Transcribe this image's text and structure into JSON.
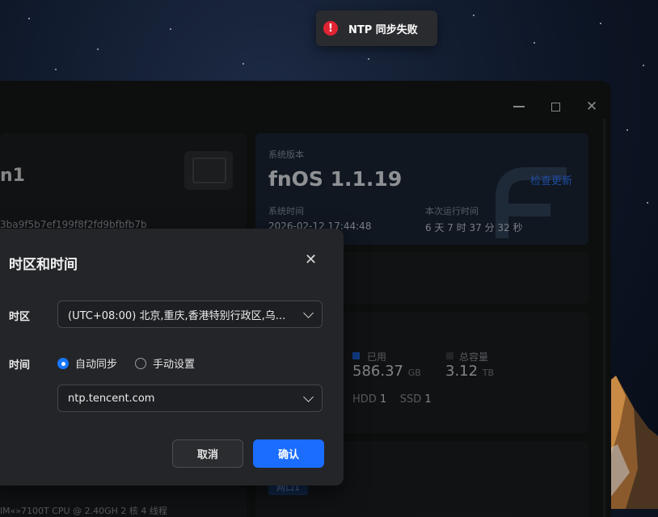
{
  "toast": {
    "icon": "error-icon",
    "message": "NTP 同步失败"
  },
  "window": {
    "controls": {
      "minimize": "minimize-icon",
      "maximize": "maximize-icon",
      "close": "✕"
    }
  },
  "device": {
    "name_fragment": "n1",
    "hash_fragment": "3ba9f5b7ef199f8f2fd9bfbfb7b",
    "cpu_fragment": "lM«»7100T CPU @ 2.40GH     2 核   4 线程"
  },
  "system": {
    "version_label": "系统版本",
    "version": "fnOS  1.1.19",
    "check_update": "检查更新",
    "time_label": "系统时间",
    "time": "2026-02-12 17:44:48",
    "uptime_label": "本次运行时间",
    "uptime": "6 天 7 时 37 分 32 秒"
  },
  "storage": {
    "used_label": "已用",
    "used_value": "586.37",
    "used_unit": "GB",
    "total_label": "总容量",
    "total_value": "3.12",
    "total_unit": "TB",
    "hdd_label": "HDD",
    "hdd_count": "1",
    "ssd_label": "SSD",
    "ssd_count": "1",
    "colors": {
      "used": "#1e5fd6",
      "total": "#3a3d42"
    }
  },
  "network": {
    "port_label": "网口1"
  },
  "dialog": {
    "title": "时区和时间",
    "close": "✕",
    "timezone_label": "时区",
    "timezone_value": "(UTC+08:00) 北京,重庆,香港特别行政区,乌...",
    "time_label": "时间",
    "auto_sync_label": "自动同步",
    "manual_label": "手动设置",
    "ntp_server": "ntp.tencent.com",
    "cancel_label": "取消",
    "confirm_label": "确认"
  },
  "colors": {
    "accent": "#1677ff",
    "error": "#e02433"
  }
}
